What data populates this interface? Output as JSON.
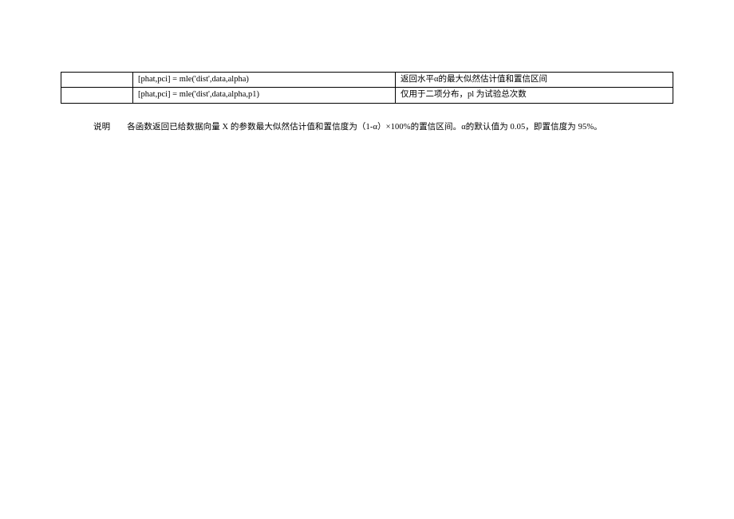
{
  "table": {
    "rows": [
      {
        "c1": "",
        "c2": "[phat,pci] = mle('dist',data,alpha)",
        "c3": "返回水平α的最大似然估计值和置信区间"
      },
      {
        "c1": "",
        "c2": "[phat,pci] = mle('dist',data,alpha,p1)",
        "c3": "仅用于二项分布，pl 为试验总次数"
      }
    ]
  },
  "explain": {
    "label": "说明",
    "text": "各函数返回已给数据向量 X 的参数最大似然估计值和置信度为（1-α）×100%的置信区间。α的默认值为 0.05，即置信度为 95%。"
  }
}
